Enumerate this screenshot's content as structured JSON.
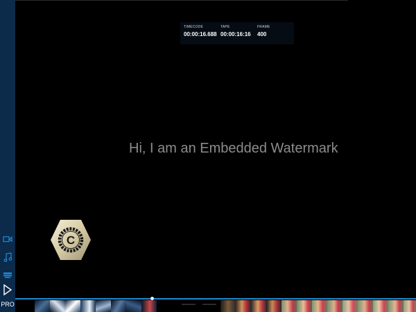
{
  "app": {
    "edition_badge": "PRO"
  },
  "sidebar": {
    "items": [
      {
        "icon": "video-camera-icon"
      },
      {
        "icon": "music-note-icon"
      },
      {
        "icon": "layers-icon"
      },
      {
        "icon": "play-icon"
      }
    ]
  },
  "timecode_panel": {
    "timecode_label": "TIMECODE",
    "timecode_value": "00:00:16.688",
    "tape_label": "TAPE",
    "tape_value": "00:00:16:16",
    "frame_label": "FRAME",
    "frame_value": "400"
  },
  "overlay": {
    "watermark_text": "Hi, I am an Embedded Watermark"
  },
  "logo": {
    "letter": "C"
  },
  "timeline": {
    "progress": 0.34
  },
  "colors": {
    "sidebar_bg": "#0c2a4a",
    "accent": "#1d8ad6",
    "watermark": "#8c8c8c"
  }
}
